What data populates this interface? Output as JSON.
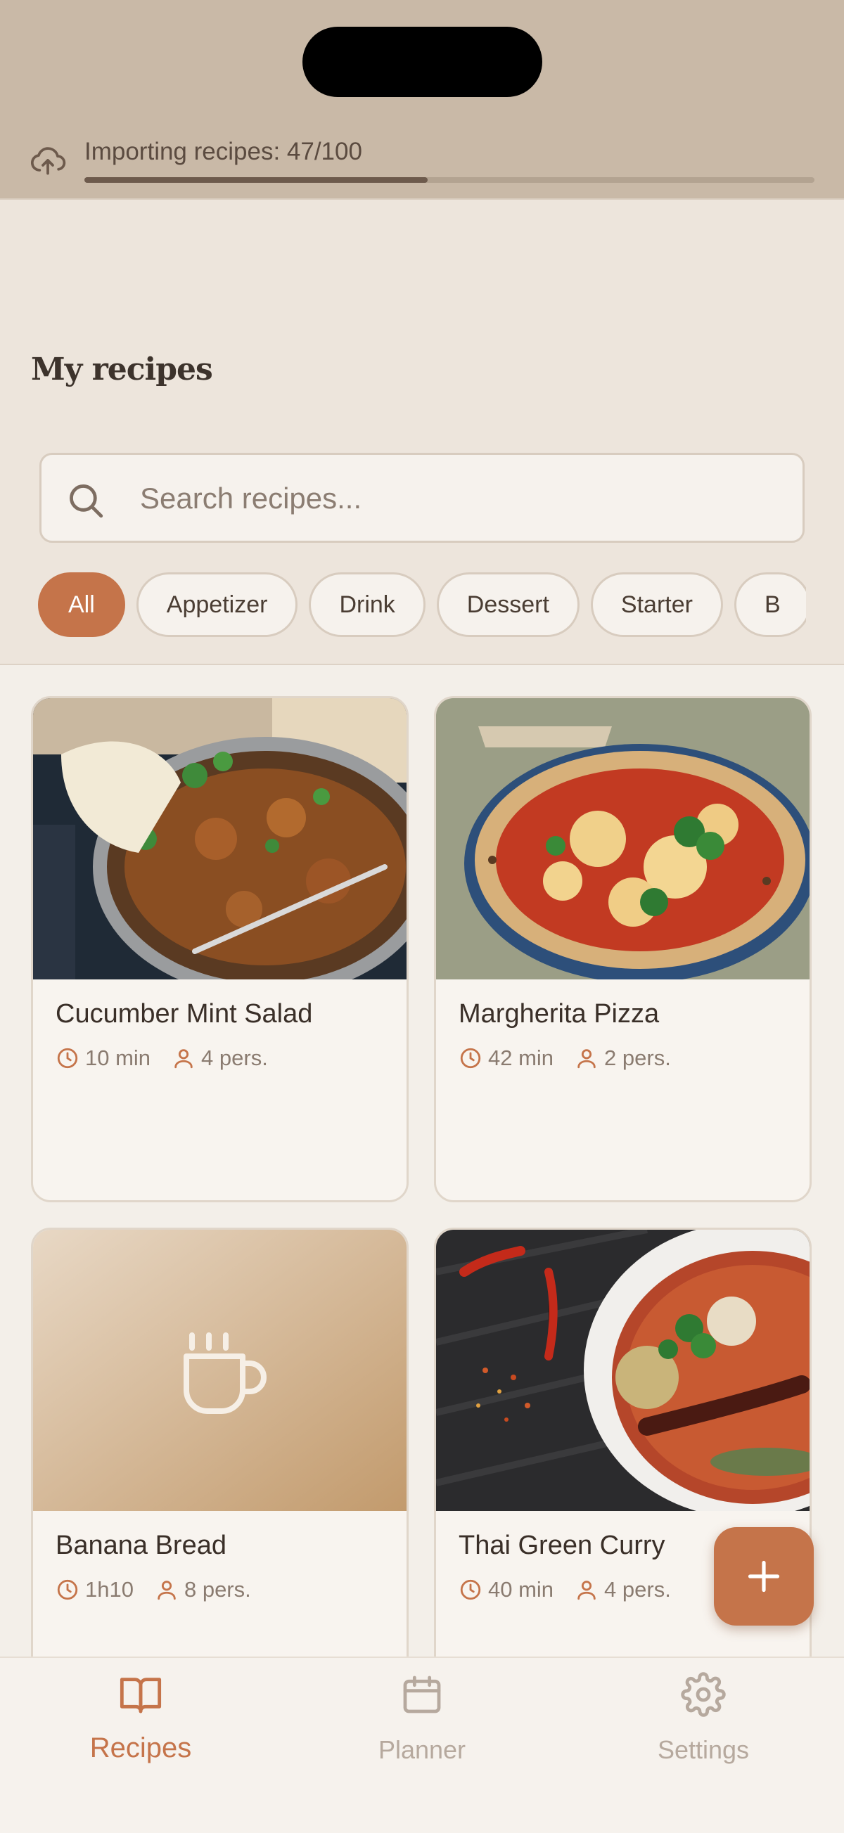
{
  "import_status": {
    "text": "Importing recipes: 47/100",
    "progress_fraction": 0.47,
    "icon": "cloud-upload-icon"
  },
  "page": {
    "title": "My recipes"
  },
  "search": {
    "placeholder": "Search recipes...",
    "value": ""
  },
  "filters": {
    "selected": "All",
    "items": [
      "All",
      "Appetizer",
      "Drink",
      "Dessert",
      "Starter",
      "B"
    ]
  },
  "recipes": [
    {
      "name": "Cucumber Mint Salad",
      "time": "10 min",
      "servings": "4 pers."
    },
    {
      "name": "Margherita Pizza",
      "time": "42 min",
      "servings": "2 pers."
    },
    {
      "name": "Banana Bread",
      "time": "1h10",
      "servings": "8 pers."
    },
    {
      "name": "Thai Green Curry",
      "time": "40 min",
      "servings": "4 pers."
    }
  ],
  "fab": {
    "icon": "plus-icon"
  },
  "nav": {
    "recipes": "Recipes",
    "planner": "Planner",
    "settings": "Settings"
  },
  "colors": {
    "accent": "#c5744a",
    "topbar": "#c9b9a7",
    "background": "#f3efe9"
  }
}
